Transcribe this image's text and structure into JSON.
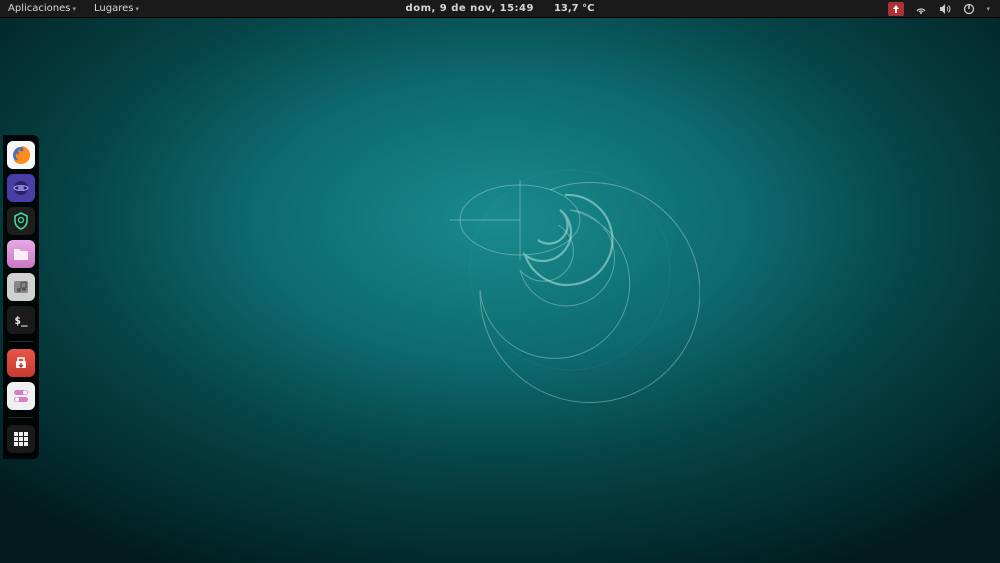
{
  "topbar": {
    "menu_applications": "Aplicaciones",
    "menu_places": "Lugares",
    "clock": "dom,  9 de nov, 15:49",
    "weather": "13,7 °C"
  },
  "dock": {
    "items": [
      {
        "name": "firefox",
        "bg": "#f7f7f7"
      },
      {
        "name": "eclipse",
        "bg": "#4a3da6"
      },
      {
        "name": "shield-app",
        "bg": "#1e1e1e"
      },
      {
        "name": "files",
        "bg": "#d98cd4"
      },
      {
        "name": "music-player",
        "bg": "#d0d0d0"
      },
      {
        "name": "terminal",
        "bg": "#1a1a1a"
      },
      {
        "name": "transmission",
        "bg": "#d94a3f"
      },
      {
        "name": "settings-toggle",
        "bg": "#f0f0f0"
      }
    ],
    "grid_label": "show-applications"
  }
}
